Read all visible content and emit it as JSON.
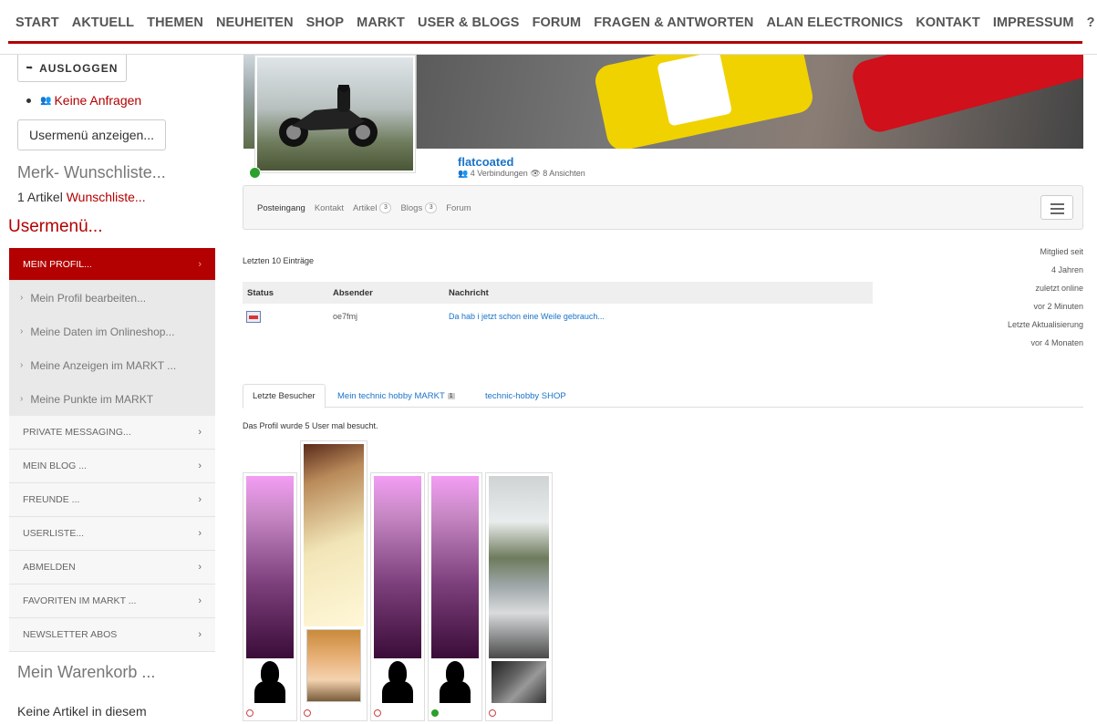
{
  "nav": {
    "items": [
      "START",
      "AKTUELL",
      "THEMEN",
      "NEUHEITEN",
      "SHOP",
      "MARKT",
      "USER & BLOGS",
      "FORUM",
      "FRAGEN & ANTWORTEN",
      "ALAN ELECTRONICS",
      "KONTAKT",
      "IMPRESSUM",
      "?"
    ]
  },
  "sidebar": {
    "logout_label": "AUSLOGGEN",
    "requests_label": "Keine Anfragen",
    "usermenu_button": "Usermenü anzeigen...",
    "wishlist_title": "Merk- Wunschliste...",
    "wishlist_count": "1 Artikel",
    "wishlist_link": "Wunschliste...",
    "usermenu_title": "Usermenü...",
    "menu": {
      "active": "MEIN PROFIL...",
      "subitems": [
        "Mein Profil bearbeiten...",
        "Meine Daten im Onlineshop...",
        "Meine Anzeigen im MARKT ...",
        "Meine Punkte im MARKT"
      ],
      "items": [
        "PRIVATE MESSAGING...",
        "MEIN BLOG ...",
        "FREUNDE ...",
        "USERLISTE...",
        "ABMELDEN",
        "FAVORITEN IM MARKT ...",
        "NEWSLETTER ABOS"
      ]
    },
    "cart_title": "Mein Warenkorb ...",
    "cart_text": "Keine Artikel in diesem"
  },
  "profile": {
    "name": "flatcoated",
    "connections": "4 Verbindungen",
    "views": "8 Ansichten"
  },
  "tabs": [
    {
      "label": "Posteingang",
      "badge": ""
    },
    {
      "label": "Kontakt",
      "badge": ""
    },
    {
      "label": "Artikel",
      "badge": "3"
    },
    {
      "label": "Blogs",
      "badge": "3"
    },
    {
      "label": "Forum",
      "badge": ""
    }
  ],
  "inbox": {
    "title": "Letzten 10 Einträge",
    "headers": [
      "Status",
      "Absender",
      "Nachricht"
    ],
    "rows": [
      {
        "sender": "oe7fmj",
        "message": "Da hab i jetzt schon eine Weile gebrauch..."
      }
    ]
  },
  "member": {
    "since_label": "Mitglied seit",
    "since_value": "4 Jahren",
    "last_online_label": "zuletzt online",
    "last_online_value": "vor 2 Minuten",
    "last_update_label": "Letzte Aktualisierung",
    "last_update_value": "vor 4 Monaten"
  },
  "lower_tabs": {
    "visitors": "Letzte Besucher",
    "market": "Mein technic hobby MARKT",
    "market_badge": "1",
    "shop": "technic-hobby SHOP"
  },
  "visits_text": "Das Profil wurde 5 User mal besucht.",
  "colors": {
    "accent": "#b30000",
    "link": "#1a73c9",
    "online": "#2ca02c"
  }
}
